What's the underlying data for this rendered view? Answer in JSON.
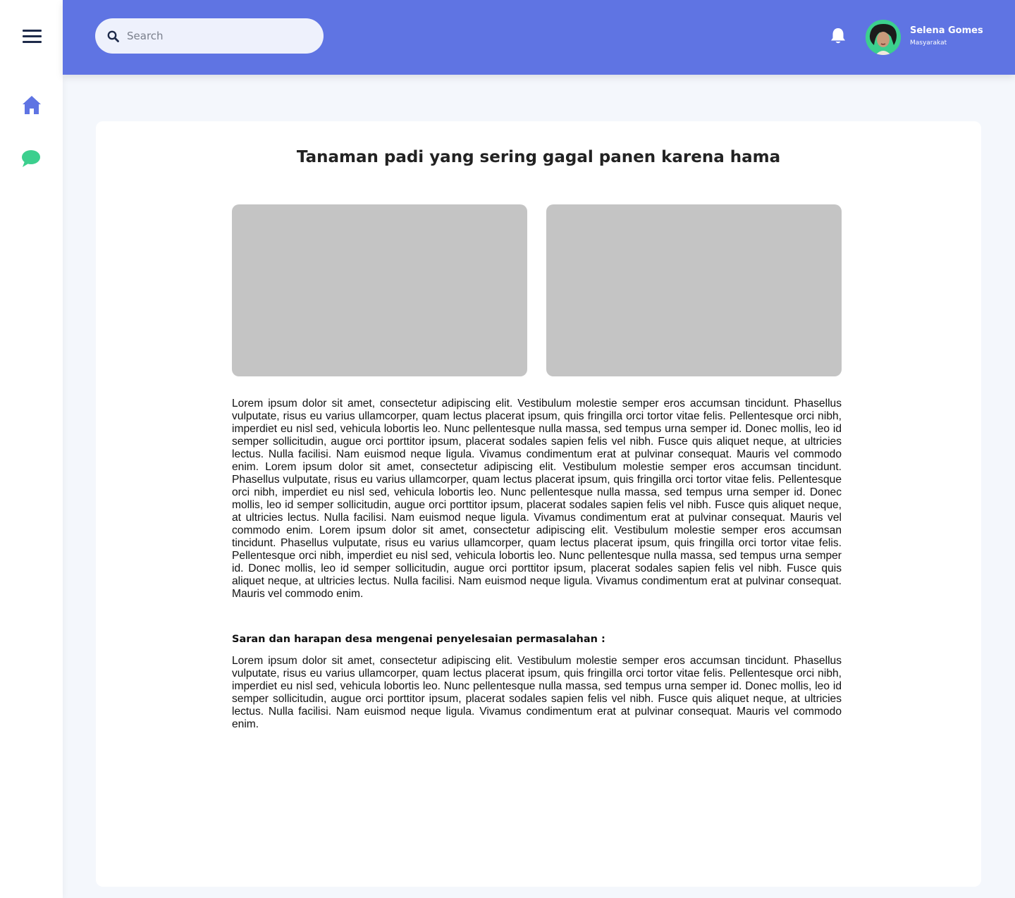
{
  "search": {
    "placeholder": "Search"
  },
  "user": {
    "name": "Selena Gomes",
    "role": "Masyarakat"
  },
  "post": {
    "title": "Tanaman padi yang sering gagal panen karena hama",
    "description": "Lorem ipsum dolor sit amet, consectetur adipiscing elit. Vestibulum molestie semper eros accumsan tincidunt. Phasellus vulputate, risus eu varius ullamcorper, quam lectus placerat ipsum, quis fringilla orci tortor vitae felis. Pellentesque orci nibh, imperdiet eu nisl sed, vehicula lobortis leo. Nunc pellentesque nulla massa, sed tempus urna semper id. Donec mollis, leo id semper sollicitudin, augue orci porttitor ipsum, placerat sodales sapien felis vel nibh. Fusce quis aliquet neque, at ultricies lectus. Nulla facilisi. Nam euismod neque ligula. Vivamus condimentum erat at pulvinar consequat. Mauris vel commodo enim. Lorem ipsum dolor sit amet, consectetur adipiscing elit. Vestibulum molestie semper eros accumsan tincidunt. Phasellus vulputate, risus eu varius ullamcorper, quam lectus placerat ipsum, quis fringilla orci tortor vitae felis. Pellentesque orci nibh, imperdiet eu nisl sed, vehicula lobortis leo. Nunc pellentesque nulla massa, sed tempus urna semper id. Donec mollis, leo id semper sollicitudin, augue orci porttitor ipsum, placerat sodales sapien felis vel nibh. Fusce quis aliquet neque, at ultricies lectus. Nulla facilisi. Nam euismod neque ligula. Vivamus condimentum erat at pulvinar consequat. Mauris vel commodo enim. Lorem ipsum dolor sit amet, consectetur adipiscing elit. Vestibulum molestie semper eros accumsan tincidunt. Phasellus vulputate, risus eu varius ullamcorper, quam lectus placerat ipsum, quis fringilla orci tortor vitae felis. Pellentesque orci nibh, imperdiet eu nisl sed, vehicula lobortis leo. Nunc pellentesque nulla massa, sed tempus urna semper id. Donec mollis, leo id semper sollicitudin, augue orci porttitor ipsum, placerat sodales sapien felis vel nibh. Fusce quis aliquet neque, at ultricies lectus. Nulla facilisi. Nam euismod neque ligula. Vivamus condimentum erat at pulvinar consequat. Mauris vel commodo enim.",
    "suggestion_heading": "Saran dan harapan desa mengenai penyelesaian permasalahan :",
    "suggestion_text": "Lorem ipsum dolor sit amet, consectetur adipiscing elit. Vestibulum molestie semper eros accumsan tincidunt. Phasellus vulputate, risus eu varius ullamcorper, quam lectus placerat ipsum, quis fringilla orci tortor vitae felis. Pellentesque orci nibh, imperdiet eu nisl sed, vehicula lobortis leo. Nunc pellentesque nulla massa, sed tempus urna semper id. Donec mollis, leo id semper sollicitudin, augue orci porttitor ipsum, placerat sodales sapien felis vel nibh. Fusce quis aliquet neque, at ultricies lectus. Nulla facilisi. Nam euismod neque ligula. Vivamus condimentum erat at pulvinar consequat. Mauris vel commodo enim."
  },
  "icons": {
    "menu": "hamburger-menu-icon",
    "home": "home-icon",
    "chat": "chat-bubble-icon",
    "search": "search-icon",
    "notifications": "bell-icon"
  },
  "colors": {
    "header": "#5f74e3",
    "home_icon": "#5f74e3",
    "chat_icon": "#3ccf8e",
    "page_background": "#f4f7fc",
    "image_placeholder": "#c4c4c4"
  }
}
